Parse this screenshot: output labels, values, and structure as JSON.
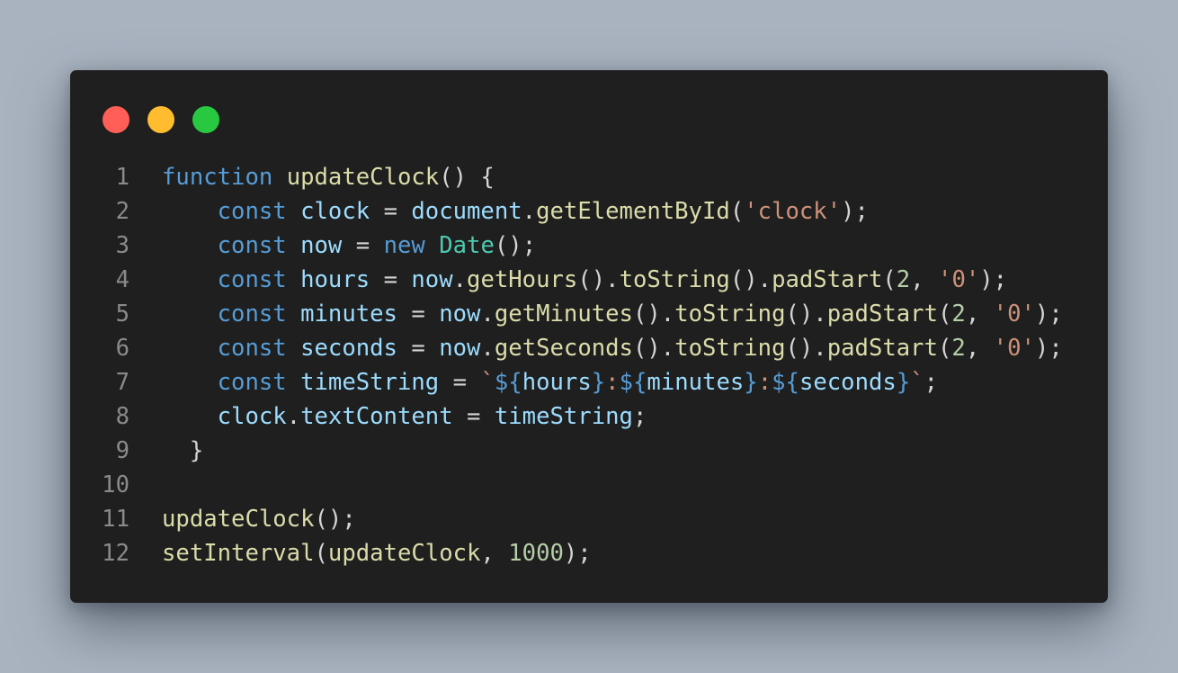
{
  "window": {
    "controls": [
      {
        "name": "close",
        "color": "#ff5f57"
      },
      {
        "name": "minimize",
        "color": "#febc2e"
      },
      {
        "name": "maximize",
        "color": "#28c840"
      }
    ]
  },
  "code": {
    "language": "javascript",
    "lines": [
      {
        "num": "1",
        "indent": "",
        "tokens": [
          {
            "t": "function",
            "c": "kw"
          },
          {
            "t": " ",
            "c": "pun"
          },
          {
            "t": "updateClock",
            "c": "fn"
          },
          {
            "t": "() {",
            "c": "pun"
          }
        ]
      },
      {
        "num": "2",
        "indent": "    ",
        "tokens": [
          {
            "t": "const",
            "c": "kw"
          },
          {
            "t": " ",
            "c": "pun"
          },
          {
            "t": "clock",
            "c": "var"
          },
          {
            "t": " = ",
            "c": "pun"
          },
          {
            "t": "document",
            "c": "var"
          },
          {
            "t": ".",
            "c": "pun"
          },
          {
            "t": "getElementById",
            "c": "fn"
          },
          {
            "t": "(",
            "c": "pun"
          },
          {
            "t": "'clock'",
            "c": "str"
          },
          {
            "t": ");",
            "c": "pun"
          }
        ]
      },
      {
        "num": "3",
        "indent": "    ",
        "tokens": [
          {
            "t": "const",
            "c": "kw"
          },
          {
            "t": " ",
            "c": "pun"
          },
          {
            "t": "now",
            "c": "var"
          },
          {
            "t": " = ",
            "c": "pun"
          },
          {
            "t": "new",
            "c": "kw"
          },
          {
            "t": " ",
            "c": "pun"
          },
          {
            "t": "Date",
            "c": "cls"
          },
          {
            "t": "();",
            "c": "pun"
          }
        ]
      },
      {
        "num": "4",
        "indent": "    ",
        "tokens": [
          {
            "t": "const",
            "c": "kw"
          },
          {
            "t": " ",
            "c": "pun"
          },
          {
            "t": "hours",
            "c": "var"
          },
          {
            "t": " = ",
            "c": "pun"
          },
          {
            "t": "now",
            "c": "var"
          },
          {
            "t": ".",
            "c": "pun"
          },
          {
            "t": "getHours",
            "c": "fn"
          },
          {
            "t": "().",
            "c": "pun"
          },
          {
            "t": "toString",
            "c": "fn"
          },
          {
            "t": "().",
            "c": "pun"
          },
          {
            "t": "padStart",
            "c": "fn"
          },
          {
            "t": "(",
            "c": "pun"
          },
          {
            "t": "2",
            "c": "num"
          },
          {
            "t": ", ",
            "c": "pun"
          },
          {
            "t": "'0'",
            "c": "str"
          },
          {
            "t": ");",
            "c": "pun"
          }
        ]
      },
      {
        "num": "5",
        "indent": "    ",
        "tokens": [
          {
            "t": "const",
            "c": "kw"
          },
          {
            "t": " ",
            "c": "pun"
          },
          {
            "t": "minutes",
            "c": "var"
          },
          {
            "t": " = ",
            "c": "pun"
          },
          {
            "t": "now",
            "c": "var"
          },
          {
            "t": ".",
            "c": "pun"
          },
          {
            "t": "getMinutes",
            "c": "fn"
          },
          {
            "t": "().",
            "c": "pun"
          },
          {
            "t": "toString",
            "c": "fn"
          },
          {
            "t": "().",
            "c": "pun"
          },
          {
            "t": "padStart",
            "c": "fn"
          },
          {
            "t": "(",
            "c": "pun"
          },
          {
            "t": "2",
            "c": "num"
          },
          {
            "t": ", ",
            "c": "pun"
          },
          {
            "t": "'0'",
            "c": "str"
          },
          {
            "t": ");",
            "c": "pun"
          }
        ]
      },
      {
        "num": "6",
        "indent": "    ",
        "tokens": [
          {
            "t": "const",
            "c": "kw"
          },
          {
            "t": " ",
            "c": "pun"
          },
          {
            "t": "seconds",
            "c": "var"
          },
          {
            "t": " = ",
            "c": "pun"
          },
          {
            "t": "now",
            "c": "var"
          },
          {
            "t": ".",
            "c": "pun"
          },
          {
            "t": "getSeconds",
            "c": "fn"
          },
          {
            "t": "().",
            "c": "pun"
          },
          {
            "t": "toString",
            "c": "fn"
          },
          {
            "t": "().",
            "c": "pun"
          },
          {
            "t": "padStart",
            "c": "fn"
          },
          {
            "t": "(",
            "c": "pun"
          },
          {
            "t": "2",
            "c": "num"
          },
          {
            "t": ", ",
            "c": "pun"
          },
          {
            "t": "'0'",
            "c": "str"
          },
          {
            "t": ");",
            "c": "pun"
          }
        ]
      },
      {
        "num": "7",
        "indent": "    ",
        "tokens": [
          {
            "t": "const",
            "c": "kw"
          },
          {
            "t": " ",
            "c": "pun"
          },
          {
            "t": "timeString",
            "c": "var"
          },
          {
            "t": " = ",
            "c": "pun"
          },
          {
            "t": "`",
            "c": "tpl"
          },
          {
            "t": "${",
            "c": "kw"
          },
          {
            "t": "hours",
            "c": "var"
          },
          {
            "t": "}",
            "c": "kw"
          },
          {
            "t": ":",
            "c": "tpl"
          },
          {
            "t": "${",
            "c": "kw"
          },
          {
            "t": "minutes",
            "c": "var"
          },
          {
            "t": "}",
            "c": "kw"
          },
          {
            "t": ":",
            "c": "tpl"
          },
          {
            "t": "${",
            "c": "kw"
          },
          {
            "t": "seconds",
            "c": "var"
          },
          {
            "t": "}",
            "c": "kw"
          },
          {
            "t": "`",
            "c": "tpl"
          },
          {
            "t": ";",
            "c": "pun"
          }
        ]
      },
      {
        "num": "8",
        "indent": "    ",
        "tokens": [
          {
            "t": "clock",
            "c": "var"
          },
          {
            "t": ".",
            "c": "pun"
          },
          {
            "t": "textContent",
            "c": "var"
          },
          {
            "t": " = ",
            "c": "pun"
          },
          {
            "t": "timeString",
            "c": "var"
          },
          {
            "t": ";",
            "c": "pun"
          }
        ]
      },
      {
        "num": "9",
        "indent": "  ",
        "tokens": [
          {
            "t": "}",
            "c": "pun"
          }
        ]
      },
      {
        "num": "10",
        "indent": "",
        "tokens": []
      },
      {
        "num": "11",
        "indent": "",
        "tokens": [
          {
            "t": "updateClock",
            "c": "fn"
          },
          {
            "t": "();",
            "c": "pun"
          }
        ]
      },
      {
        "num": "12",
        "indent": "",
        "tokens": [
          {
            "t": "setInterval",
            "c": "fn"
          },
          {
            "t": "(",
            "c": "pun"
          },
          {
            "t": "updateClock",
            "c": "fn"
          },
          {
            "t": ", ",
            "c": "pun"
          },
          {
            "t": "1000",
            "c": "num"
          },
          {
            "t": ");",
            "c": "pun"
          }
        ]
      }
    ]
  }
}
